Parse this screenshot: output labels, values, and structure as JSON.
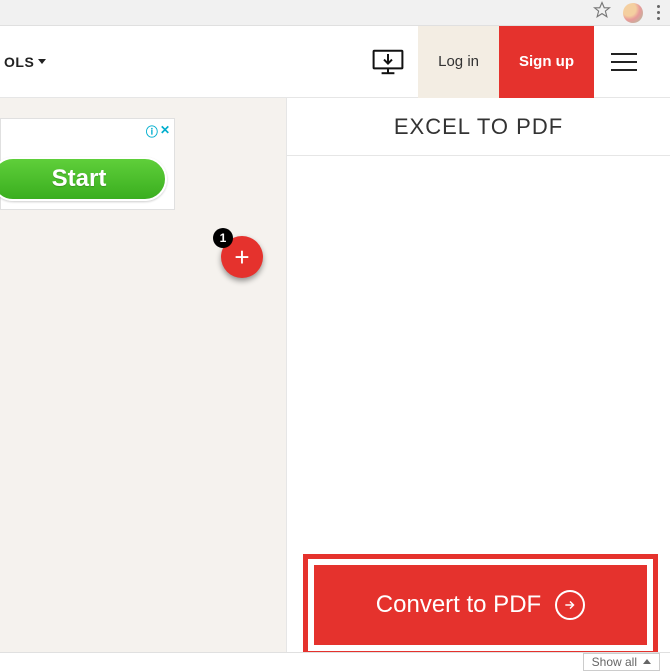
{
  "browser": {
    "star_aria": "Bookmark",
    "menu_aria": "Chrome menu"
  },
  "header": {
    "tools_label": "OLS",
    "login_label": "Log in",
    "signup_label": "Sign up"
  },
  "ad": {
    "button_label": "Start",
    "info_symbol": "ⓘ",
    "close_symbol": "✕"
  },
  "fab": {
    "badge_count": "1"
  },
  "panel": {
    "title": "EXCEL TO PDF",
    "convert_label": "Convert to PDF"
  },
  "footer": {
    "showall_label": "Show all"
  }
}
